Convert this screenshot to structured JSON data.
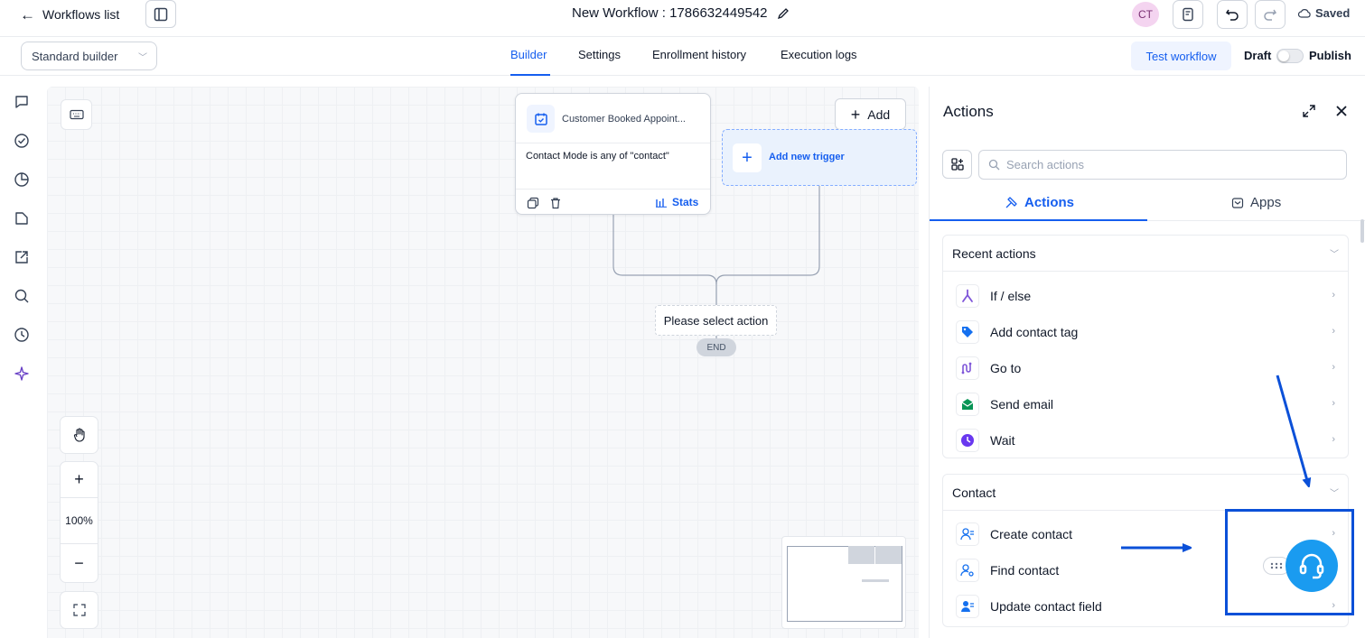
{
  "header": {
    "back_label": "Workflows list",
    "workflow_title": "New Workflow : 1786632449542",
    "avatar_initials": "CT",
    "saved_label": "Saved"
  },
  "subbar": {
    "builder_select": "Standard builder",
    "tabs": [
      {
        "label": "Builder",
        "active": true
      },
      {
        "label": "Settings",
        "active": false
      },
      {
        "label": "Enrollment history",
        "active": false
      },
      {
        "label": "Execution logs",
        "active": false
      }
    ],
    "test_workflow": "Test workflow",
    "draft_label": "Draft",
    "publish_label": "Publish",
    "publish_on": false
  },
  "left_rail": {
    "icons": [
      "chat-icon",
      "check-circle-icon",
      "pie-chart-icon",
      "document-icon",
      "external-link-icon",
      "search-icon",
      "history-icon",
      "sparkle-icon"
    ]
  },
  "canvas": {
    "trigger": {
      "name": "Customer Booked Appoint...",
      "condition": "Contact Mode is any of \"contact\"",
      "stats_label": "Stats"
    },
    "add_label": "Add",
    "add_trigger_label": "Add new trigger",
    "placeholder_action": "Please select action",
    "end_label": "END",
    "zoom": "100%"
  },
  "panel": {
    "title": "Actions",
    "search_placeholder": "Search actions",
    "tabs": [
      {
        "label": "Actions",
        "active": true
      },
      {
        "label": "Apps",
        "active": false
      }
    ],
    "sections": [
      {
        "title": "Recent actions",
        "items": [
          {
            "label": "If / else",
            "icon": "branch-icon"
          },
          {
            "label": "Add contact tag",
            "icon": "tag-icon"
          },
          {
            "label": "Go to",
            "icon": "goto-icon"
          },
          {
            "label": "Send email",
            "icon": "email-icon"
          },
          {
            "label": "Wait",
            "icon": "clock-icon"
          }
        ]
      },
      {
        "title": "Contact",
        "items": [
          {
            "label": "Create contact",
            "icon": "user-plus-icon"
          },
          {
            "label": "Find contact",
            "icon": "user-search-icon"
          },
          {
            "label": "Update contact field",
            "icon": "user-edit-icon"
          }
        ]
      }
    ]
  },
  "colors": {
    "accent": "#155eef",
    "annotation": "#0b50d8",
    "support_bubble": "#1a9bf0"
  }
}
